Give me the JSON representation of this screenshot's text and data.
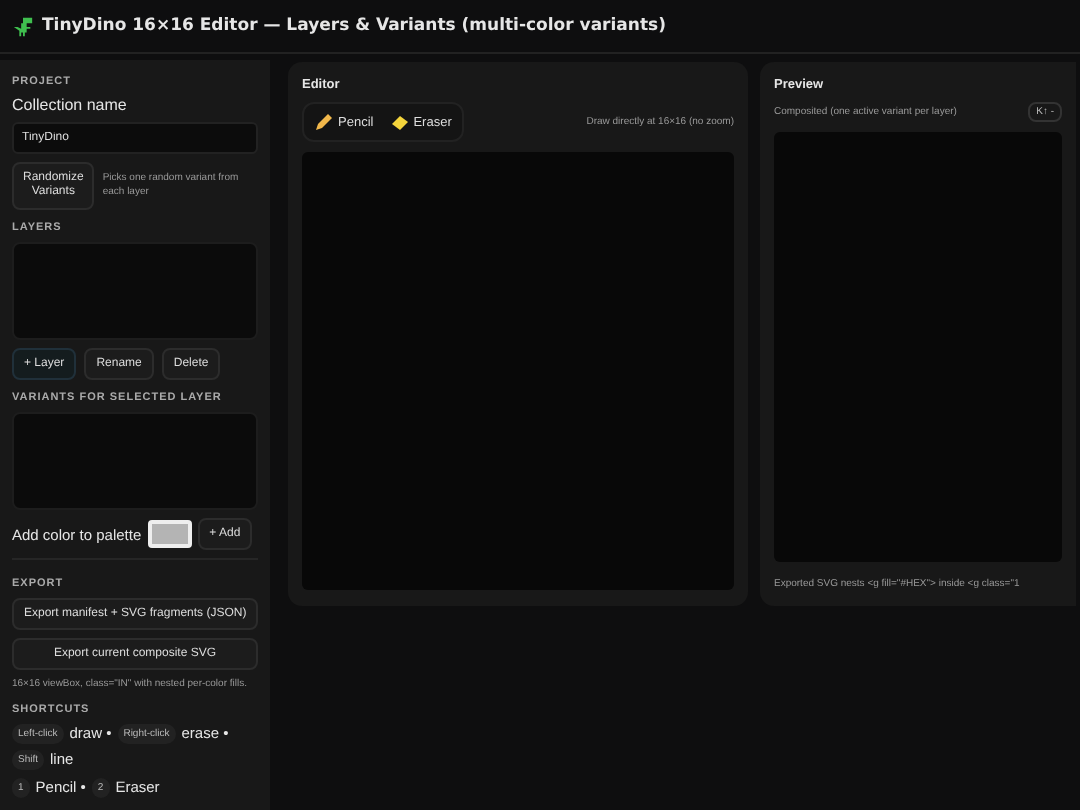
{
  "window": {
    "title": "TinyDino 16×16 Editor — Layers & Variants (multi-color variants)"
  },
  "sidebar": {
    "project": {
      "heading": "PROJECT",
      "name_label": "Collection name",
      "name_value": "TinyDino",
      "randomize_button": "Randomize Variants",
      "randomize_hint": "Picks one random variant from each layer"
    },
    "layers": {
      "heading": "LAYERS",
      "buttons": [
        {
          "label": "+ Layer",
          "primary": true
        },
        {
          "label": "Rename",
          "primary": false
        },
        {
          "label": "Delete",
          "primary": false
        }
      ]
    },
    "variants": {
      "heading": "VARIANTS FOR SELECTED LAYER",
      "palette_label": "Add color to palette",
      "add_button": "+ Add"
    },
    "export": {
      "heading": "EXPORT",
      "buttons": [
        "Export manifest + SVG fragments (JSON)",
        "Export current composite SVG"
      ],
      "hint": "16×16 viewBox, class=\"IN\" with nested per-color fills."
    },
    "shortcuts": {
      "heading": "SHORTCUTS",
      "lines": [
        [
          {
            "key": "Left-click",
            "action": "draw •"
          },
          {
            "key": "Right-click",
            "action": "erase •"
          },
          {
            "key": "Shift",
            "action": "line"
          }
        ],
        [
          {
            "key": "1",
            "action": "Pencil •"
          },
          {
            "key": "2",
            "action": "Eraser"
          }
        ]
      ]
    }
  },
  "editor": {
    "title": "Editor",
    "tools": [
      {
        "label": "Pencil",
        "kind": "pencil",
        "selected": false
      },
      {
        "label": "Eraser",
        "kind": "eraser",
        "selected": false
      }
    ],
    "hint": "Draw directly at 16×16 (no zoom)"
  },
  "preview": {
    "title": "Preview",
    "caption": "Composited (one active variant per layer)",
    "badge": "K↑ -",
    "footnote": "Exported SVG nests <g fill=\"#HEX\"> inside <g class=\"1"
  }
}
